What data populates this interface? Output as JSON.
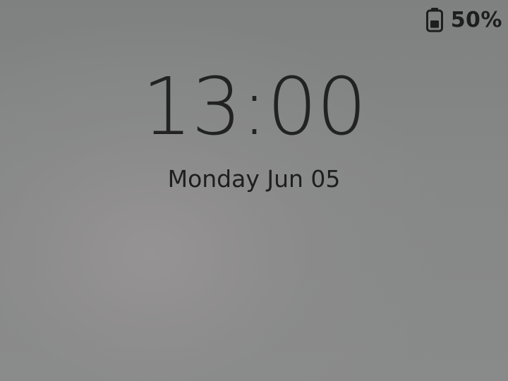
{
  "status_bar": {
    "battery_icon": "battery-half-icon",
    "battery_level": 0.5,
    "battery_text": "50%"
  },
  "lock_screen": {
    "time": "13:00",
    "date": "Monday Jun 05"
  }
}
